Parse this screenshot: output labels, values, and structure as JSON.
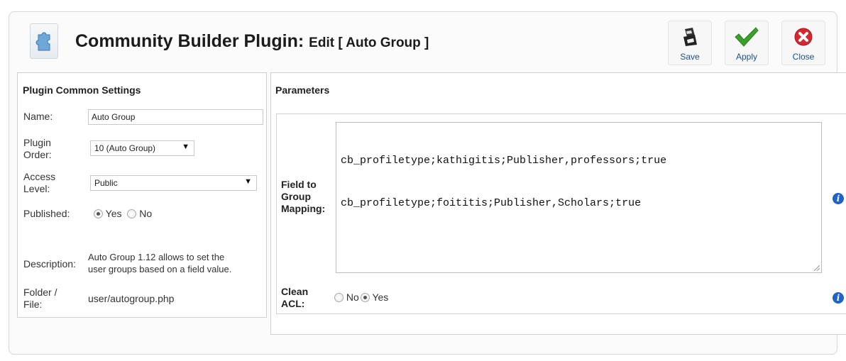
{
  "header": {
    "title": "Community Builder Plugin:",
    "subtitle": "Edit [ Auto Group ]",
    "icon": "puzzle-piece-icon"
  },
  "toolbar": {
    "save_label": "Save",
    "apply_label": "Apply",
    "close_label": "Close",
    "save_icon": "save-floppy-icon",
    "apply_icon": "checkmark-icon",
    "close_icon": "close-x-icon"
  },
  "common_settings": {
    "heading": "Plugin Common Settings",
    "name_label": "Name:",
    "name_value": "Auto Group",
    "order_label_line1": "Plugin",
    "order_label_line2": "Order:",
    "order_value": "10 (Auto Group)",
    "access_label_line1": "Access",
    "access_label_line2": "Level:",
    "access_value": "Public",
    "published_label": "Published:",
    "published_yes": "Yes",
    "published_no": "No",
    "published_selected": "Yes",
    "description_label": "Description:",
    "description_line1": "Auto Group 1.12 allows to set the",
    "description_line2": "user groups based on a field value.",
    "folder_label_line1": "Folder /",
    "folder_label_line2": "File:",
    "folder_value": "user/autogroup.php"
  },
  "parameters": {
    "heading": "Parameters",
    "mapping_label_line1": "Field to",
    "mapping_label_line2": "Group",
    "mapping_label_line3": "Mapping:",
    "mapping_line1": "cb_profiletype;kathigitis;Publisher,professors;true",
    "mapping_line2": "cb_profiletype;foititis;Publisher,Scholars;true",
    "clean_acl_label_line1": "Clean",
    "clean_acl_label_line2": "ACL:",
    "clean_acl_no": "No",
    "clean_acl_yes": "Yes",
    "clean_acl_selected": "Yes",
    "info_icon": "info-icon"
  },
  "colors": {
    "toolbar_label": "#1d4f8a",
    "apply_green": "#3aa12a",
    "close_red": "#d7262d",
    "info_blue": "#1f63c6"
  }
}
